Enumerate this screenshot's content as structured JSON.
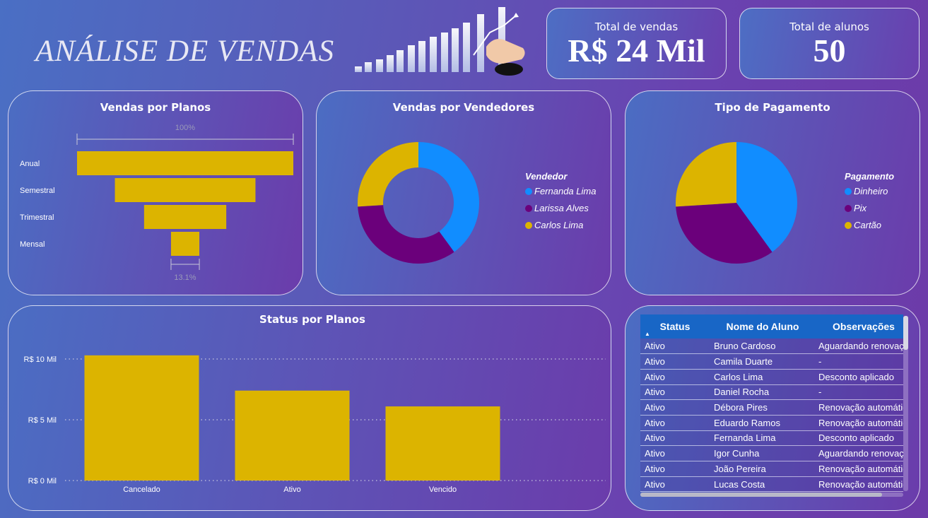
{
  "header": {
    "title": "ANÁLISE DE VENDAS",
    "hero_image": "growth-bars-hand-icon"
  },
  "kpis": [
    {
      "label": "Total de vendas",
      "value": "R$ 24 Mil"
    },
    {
      "label": "Total de alunos",
      "value": "50"
    }
  ],
  "colors": {
    "yellow": "#dcb400",
    "blue": "#118dff",
    "purple": "#6b007b"
  },
  "funnel": {
    "title": "Vendas por Planos",
    "top_label": "100%",
    "bottom_label": "13.1%",
    "categories": [
      "Anual",
      "Semestral",
      "Trimestral",
      "Mensal"
    ],
    "values": [
      100,
      65,
      38,
      13.1
    ]
  },
  "donut": {
    "title": "Vendas por Vendedores",
    "legend_title": "Vendedor",
    "labels": [
      "Fernanda Lima",
      "Larissa Alves",
      "Carlos Lima"
    ],
    "values": [
      40,
      34,
      26
    ]
  },
  "pie": {
    "title": "Tipo de Pagamento",
    "legend_title": "Pagamento",
    "labels": [
      "Dinheiro",
      "Pix",
      "Cartão"
    ],
    "values": [
      40,
      34,
      26
    ]
  },
  "chart_data": [
    {
      "type": "bar",
      "title": "Vendas por Planos",
      "categories": [
        "Anual",
        "Semestral",
        "Trimestral",
        "Mensal"
      ],
      "values": [
        100,
        65,
        38,
        13.1
      ]
    },
    {
      "type": "pie",
      "title": "Vendas por Vendedores",
      "categories": [
        "Fernanda Lima",
        "Larissa Alves",
        "Carlos Lima"
      ],
      "values": [
        40,
        34,
        26
      ]
    },
    {
      "type": "pie",
      "title": "Tipo de Pagamento",
      "categories": [
        "Dinheiro",
        "Pix",
        "Cartão"
      ],
      "values": [
        40,
        34,
        26
      ]
    },
    {
      "type": "bar",
      "title": "Status por Planos",
      "categories": [
        "Cancelado",
        "Ativo",
        "Vencido"
      ],
      "values": [
        10.3,
        7.4,
        6.1
      ],
      "ylim": [
        0,
        10
      ],
      "yticks": [
        "R$ 0 Mil",
        "R$ 5 Mil",
        "R$ 10 Mil"
      ]
    }
  ],
  "status_chart": {
    "title": "Status por Planos",
    "categories": [
      "Cancelado",
      "Ativo",
      "Vencido"
    ],
    "values": [
      10.3,
      7.4,
      6.1
    ],
    "ymax": 10,
    "yticks": [
      {
        "v": 0,
        "label": "R$ 0 Mil"
      },
      {
        "v": 5,
        "label": "R$ 5 Mil"
      },
      {
        "v": 10,
        "label": "R$ 10 Mil"
      }
    ]
  },
  "table": {
    "columns": [
      "Status",
      "Nome do Aluno",
      "Observações"
    ],
    "sort_icon": "sort-ascending-icon",
    "rows": [
      [
        "Ativo",
        "Bruno Cardoso",
        "Aguardando renovação"
      ],
      [
        "Ativo",
        "Camila Duarte",
        "-"
      ],
      [
        "Ativo",
        "Carlos Lima",
        "Desconto aplicado"
      ],
      [
        "Ativo",
        "Daniel Rocha",
        "-"
      ],
      [
        "Ativo",
        "Débora Pires",
        "Renovação automática"
      ],
      [
        "Ativo",
        "Eduardo Ramos",
        "Renovação automática"
      ],
      [
        "Ativo",
        "Fernanda Lima",
        "Desconto aplicado"
      ],
      [
        "Ativo",
        "Igor Cunha",
        "Aguardando renovação"
      ],
      [
        "Ativo",
        "João Pereira",
        "Renovação automática"
      ],
      [
        "Ativo",
        "Lucas Costa",
        "Renovação automática"
      ]
    ]
  }
}
